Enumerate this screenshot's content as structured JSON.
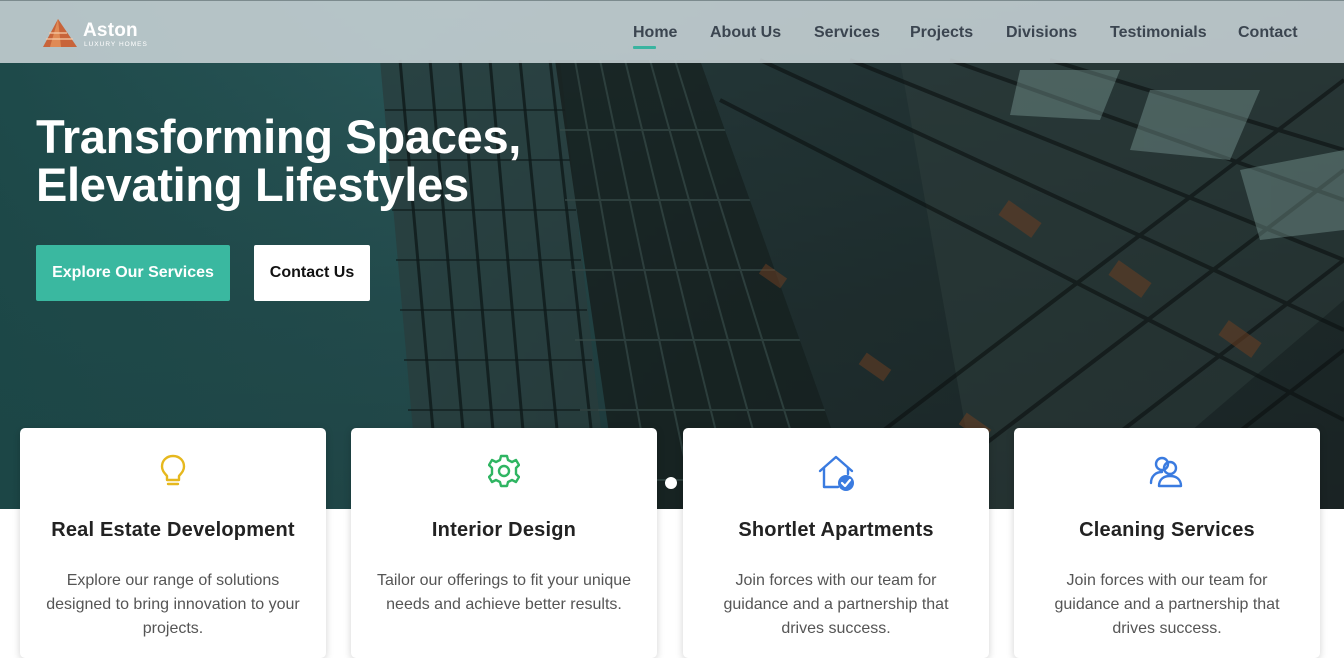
{
  "brand": {
    "name": "Aston",
    "tagline": "LUXURY HOMES",
    "accent": "#3ab8a0",
    "logo_color": "#c8643a"
  },
  "nav": {
    "items": [
      "Home",
      "About Us",
      "Services",
      "Projects",
      "Divisions",
      "Testimonials",
      "Contact"
    ],
    "active": "Home"
  },
  "hero": {
    "title_line1": "Transforming Spaces,",
    "title_line2": "Elevating Lifestyles",
    "primary_button": "Explore Our Services",
    "secondary_button": "Contact Us",
    "carousel_slides": 1
  },
  "cards": [
    {
      "icon": "lightbulb-icon",
      "icon_color": "#e6b81e",
      "title": "Real Estate Development",
      "description": "Explore our range of solutions designed to bring innovation to your projects."
    },
    {
      "icon": "gear-icon",
      "icon_color": "#2fb562",
      "title": "Interior Design",
      "description": "Tailor our offerings to fit your unique needs and achieve better results."
    },
    {
      "icon": "home-check-icon",
      "icon_color": "#3a7be0",
      "title": "Shortlet Apartments",
      "description": "Join forces with our team for guidance and a partnership that drives success."
    },
    {
      "icon": "users-icon",
      "icon_color": "#3a7be0",
      "title": "Cleaning Services",
      "description": "Join forces with our team for guidance and a partnership that drives success."
    }
  ]
}
